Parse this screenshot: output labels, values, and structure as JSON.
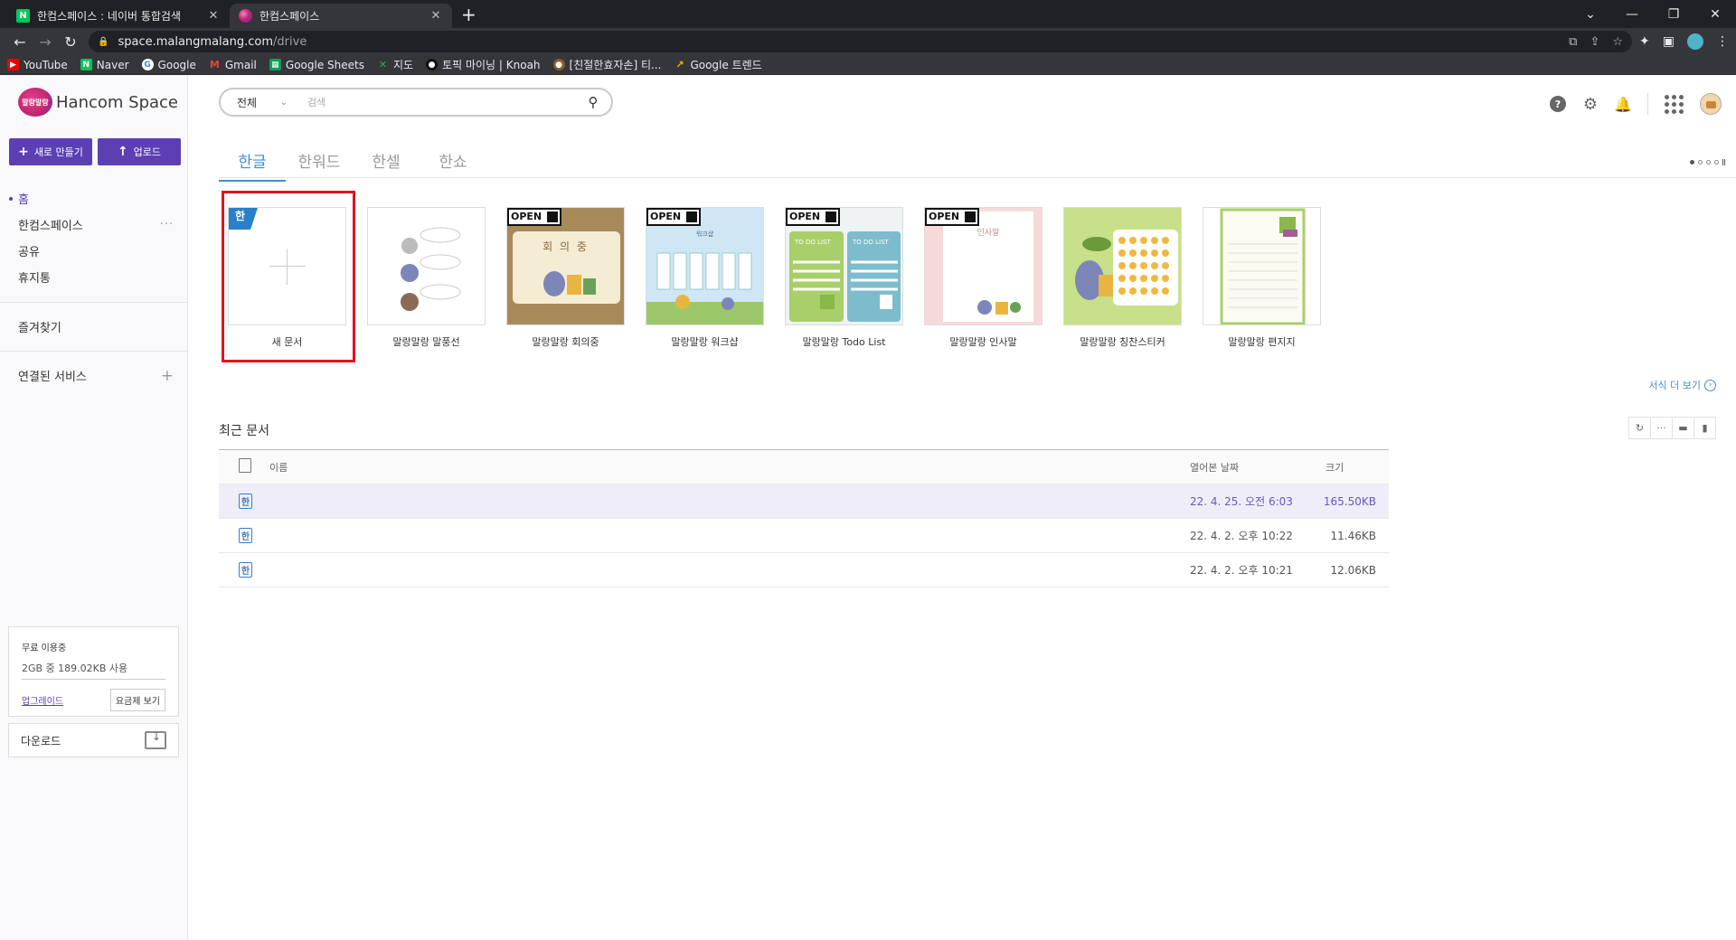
{
  "browser": {
    "tabs": [
      {
        "title": "한컴스페이스 : 네이버 통합검색",
        "favicon": "naver-icon"
      },
      {
        "title": "한컴스페이스",
        "favicon": "hancom-icon"
      }
    ],
    "url_host": "space.malangmalang.com",
    "url_path": "/drive",
    "bookmarks": [
      "YouTube",
      "Naver",
      "Google",
      "Gmail",
      "Google Sheets",
      "지도",
      "토픽 마이닝 | Knoah",
      "[친절한효자손] 티...",
      "Google 트렌드"
    ]
  },
  "sidebar": {
    "logo_mark": "말랑말랑",
    "logo_text": "Hancom Space",
    "new_button": "새로 만들기",
    "upload_button": "업로드",
    "nav": [
      "홈",
      "한컴스페이스",
      "공유",
      "휴지통"
    ],
    "favorites": "즐겨찾기",
    "connected": "연결된 서비스",
    "usage": {
      "title": "무료 이용중",
      "amount": "2GB 중 189.02KB 사용",
      "upgrade": "업그레이드",
      "pricing": "요금제 보기"
    },
    "download": "다운로드"
  },
  "search": {
    "scope": "전체",
    "placeholder": "검색"
  },
  "file_tabs": [
    "한글",
    "한워드",
    "한셀",
    "한쇼"
  ],
  "templates": [
    {
      "label": "새 문서"
    },
    {
      "label": "말랑말랑 말풍선"
    },
    {
      "label": "말랑말랑 회의중",
      "thumb_text": "회 의 중"
    },
    {
      "label": "말랑말랑 워크샵",
      "thumb_text": "워크샵"
    },
    {
      "label": "말랑말랑 Todo List",
      "thumb_text": "TO DO LIST"
    },
    {
      "label": "말랑말랑 인사말",
      "thumb_text": "인사말"
    },
    {
      "label": "말랑말랑 칭찬스티커"
    },
    {
      "label": "말랑말랑 편지지"
    }
  ],
  "badges": {
    "open": "OPEN",
    "hwp": "한"
  },
  "more_templates": "서식 더 보기",
  "recent": {
    "title": "최근 문서",
    "headers": {
      "name": "이름",
      "date": "열어본 날짜",
      "size": "크기"
    },
    "rows": [
      {
        "name": "",
        "date": "22. 4. 25. 오전 6:03",
        "size": "165.50KB"
      },
      {
        "name": "",
        "date": "22. 4. 2. 오후 10:22",
        "size": "11.46KB"
      },
      {
        "name": "",
        "date": "22. 4. 2. 오후 10:21",
        "size": "12.06KB"
      }
    ]
  },
  "colors": {
    "accent": "#5b3fb3",
    "tab_active": "#3f8fd0",
    "highlight": "#e0141d"
  }
}
